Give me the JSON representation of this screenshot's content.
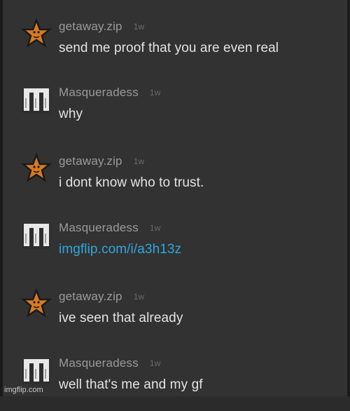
{
  "messages": [
    {
      "user": "getaway.zip",
      "time": "1w",
      "text": "send me proof that you are even real",
      "avatar": "star-icon",
      "is_link": false
    },
    {
      "user": "Masqueradess",
      "time": "1w",
      "text": "why",
      "avatar": "m-logo-icon",
      "is_link": false
    },
    {
      "user": "getaway.zip",
      "time": "1w",
      "text": "i dont know who to trust.",
      "avatar": "star-icon",
      "is_link": false
    },
    {
      "user": "Masqueradess",
      "time": "1w",
      "text": "imgflip.com/i/a3h13z",
      "avatar": "m-logo-icon",
      "is_link": true
    },
    {
      "user": "getaway.zip",
      "time": "1w",
      "text": "ive seen that already",
      "avatar": "star-icon",
      "is_link": false
    },
    {
      "user": "Masqueradess",
      "time": "1w",
      "text": "well that's me and my gf",
      "avatar": "m-logo-icon",
      "is_link": false
    }
  ],
  "watermark": "imgflip.com",
  "colors": {
    "background": "#323232",
    "username": "#9a9a9a",
    "timestamp": "#6b6b6b",
    "message_text": "#e3e3e3",
    "link": "#2fa7dc",
    "star_fill": "#d97a1e"
  }
}
